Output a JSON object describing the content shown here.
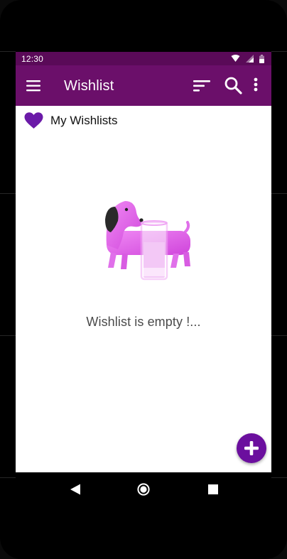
{
  "status_bar": {
    "time": "12:30",
    "icons": [
      "wifi-icon",
      "cell-signal-icon",
      "battery-icon"
    ]
  },
  "app_bar": {
    "title": "Wishlist",
    "actions": [
      "menu-icon",
      "sort-icon",
      "search-icon",
      "more-vert-icon"
    ]
  },
  "section": {
    "icon": "heart-icon",
    "title": "My Wishlists"
  },
  "empty_state": {
    "illustration": "dog-with-glass-illustration",
    "message": "Wishlist is empty !..."
  },
  "fab": {
    "icon": "plus-icon"
  },
  "nav_bar": {
    "buttons": [
      "back-icon",
      "home-icon",
      "recents-icon"
    ]
  },
  "colors": {
    "status_bar": "#5a0a58",
    "app_bar": "#6b0f6a",
    "accent": "#6b0f9e",
    "illustration_pink": "#e060e8"
  }
}
